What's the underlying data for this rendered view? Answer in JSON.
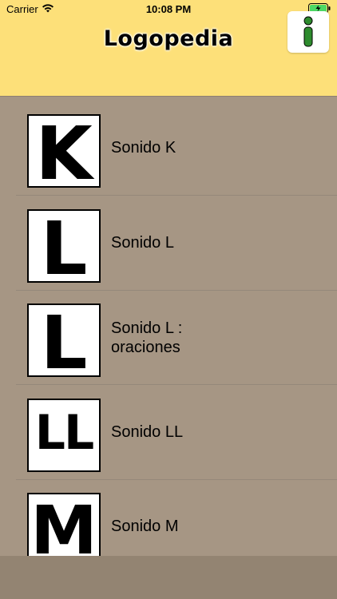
{
  "status_bar": {
    "carrier": "Carrier",
    "time": "10:08 PM"
  },
  "header": {
    "title": "Logopedia",
    "info_icon": "info-icon"
  },
  "colors": {
    "header_bg": "#fde079",
    "list_bg": "#a69684",
    "info_green": "#2e8b2e"
  },
  "items": [
    {
      "letter": "K",
      "label": "Sonido K"
    },
    {
      "letter": "L",
      "label": "Sonido L"
    },
    {
      "letter": "L",
      "label_line1": "Sonido L :",
      "label_line2": "oraciones"
    },
    {
      "letter": "LL",
      "label": "Sonido LL"
    },
    {
      "letter": "M",
      "label": "Sonido M"
    }
  ]
}
